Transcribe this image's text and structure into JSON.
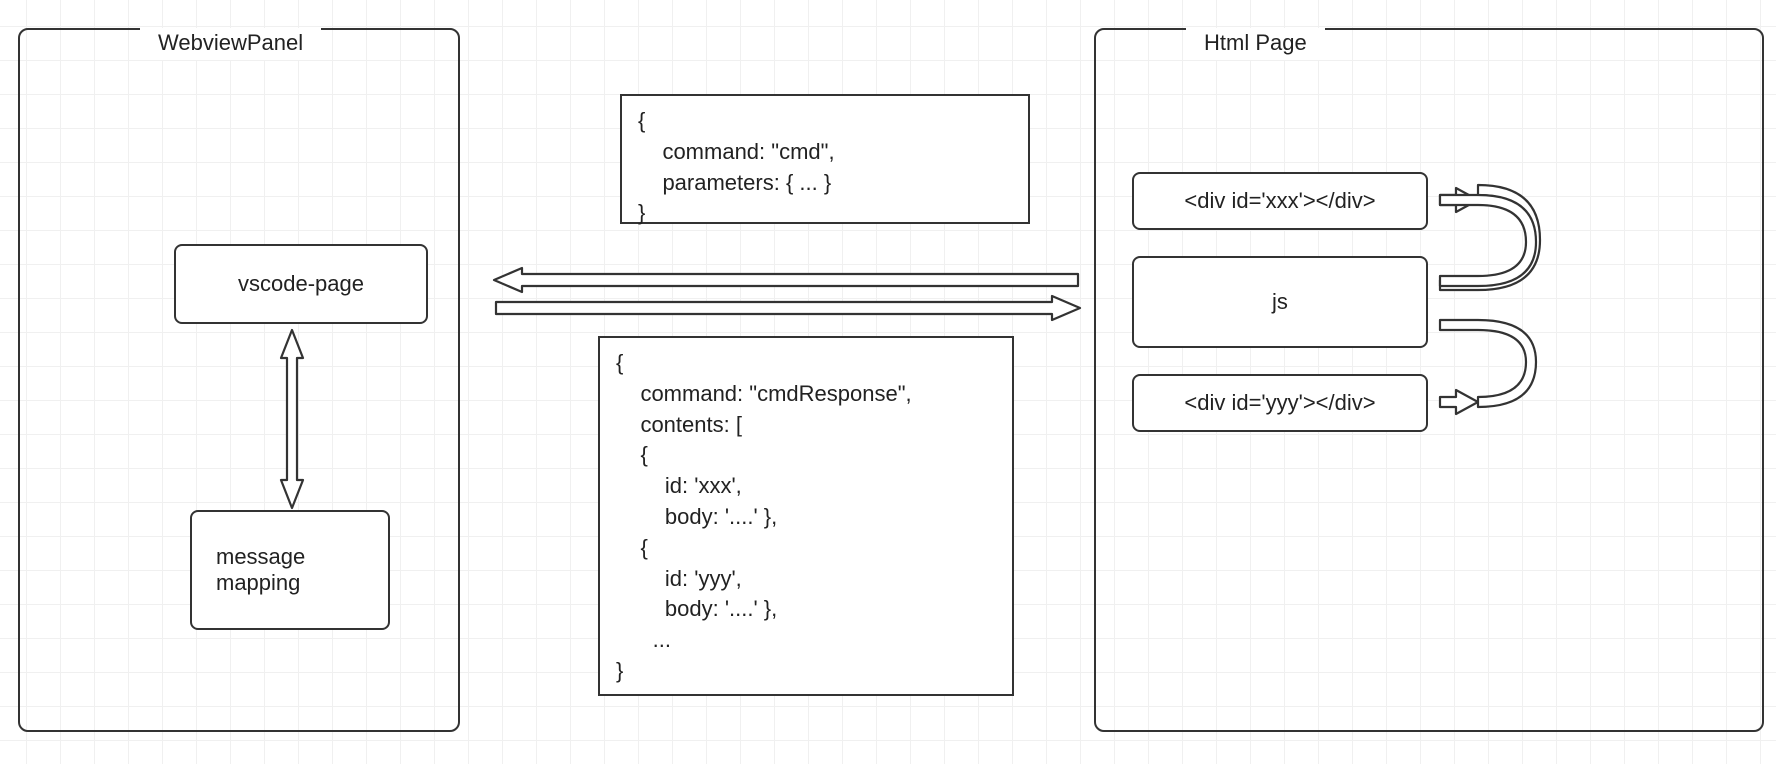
{
  "left": {
    "title": "WebviewPanel",
    "box1": "vscode-page",
    "box2_l1": "message",
    "box2_l2": "mapping"
  },
  "middle": {
    "payloadTop_l1": "{",
    "payloadTop_l2": "    command: \"cmd\",",
    "payloadTop_l3": "    parameters: { ... }",
    "payloadTop_l4": "}",
    "payloadBottom_l1": "{",
    "payloadBottom_l2": "    command: \"cmdResponse\",",
    "payloadBottom_l3": "    contents: [",
    "payloadBottom_l4": "    {",
    "payloadBottom_l5": "        id: 'xxx',",
    "payloadBottom_l6": "        body: '....' },",
    "payloadBottom_l7": "    {",
    "payloadBottom_l8": "        id: 'yyy',",
    "payloadBottom_l9": "        body: '....' },",
    "payloadBottom_l10": "      ...",
    "payloadBottom_l11": "}"
  },
  "right": {
    "title": "Html Page",
    "box1": "<div id='xxx'></div>",
    "box2": "js",
    "box3": "<div id='yyy'></div>"
  }
}
